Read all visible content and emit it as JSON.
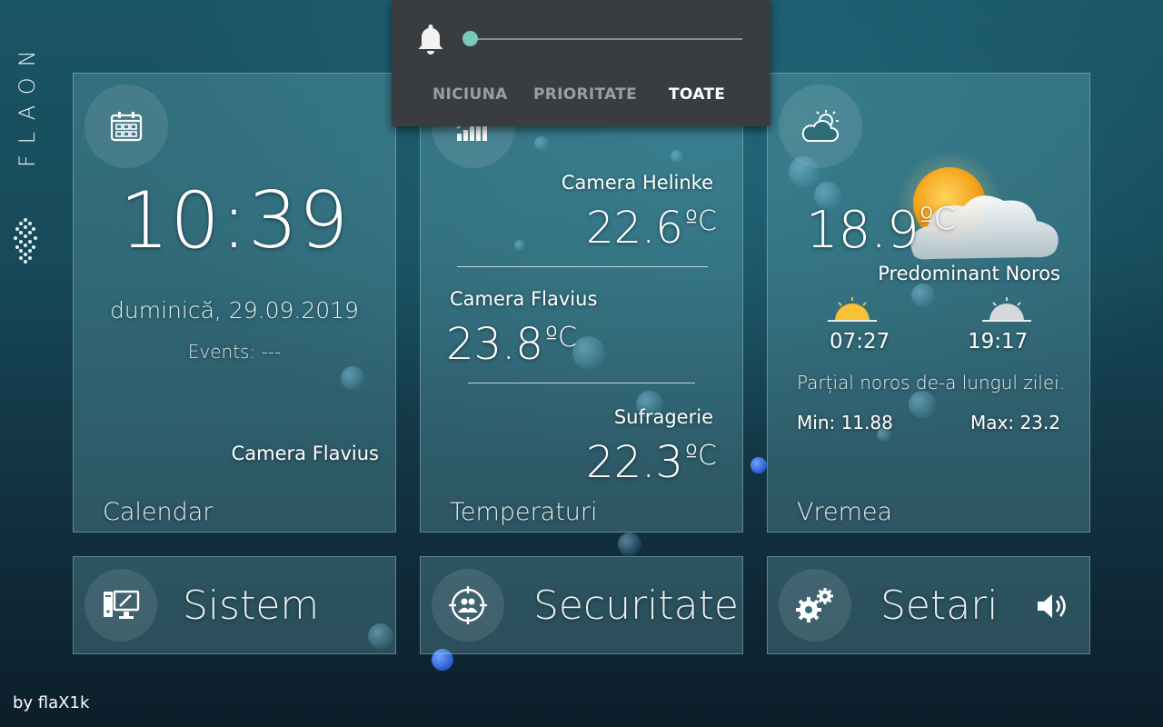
{
  "logo": {
    "text": "FLAON"
  },
  "notifications": {
    "options": [
      "NICIUNA",
      "PRIORITATE",
      "TOATE"
    ],
    "active": "TOATE"
  },
  "calendar": {
    "time": "10:39",
    "date": "duminică, 29.09.2019",
    "events": "Events: ---",
    "room": "Camera Flavius",
    "title": "Calendar"
  },
  "temperatures": {
    "title": "Temperaturi",
    "rooms": [
      {
        "name": "Camera Helinke",
        "temp": "22.6",
        "unit": "ºC"
      },
      {
        "name": "Camera Flavius",
        "temp": "23.8",
        "unit": "ºC"
      },
      {
        "name": "Sufragerie",
        "temp": "22.3",
        "unit": "ºC"
      }
    ]
  },
  "weather": {
    "title": "Vremea",
    "temp": "18.9",
    "unit": "ºC",
    "condition": "Predominant Noros",
    "sunrise": "07:27",
    "sunset": "19:17",
    "description": "Parțial noros de-a lungul zilei.",
    "min": "Min: 11.88",
    "max": "Max: 23.2"
  },
  "bottom": {
    "system": "Sistem",
    "security": "Securitate",
    "settings": "Setari"
  },
  "footer": {
    "credit": "by flaX1k"
  },
  "colors": {
    "accent": "#78c9bd",
    "panel": "#3a3d40",
    "tile": "#4f8f99"
  }
}
